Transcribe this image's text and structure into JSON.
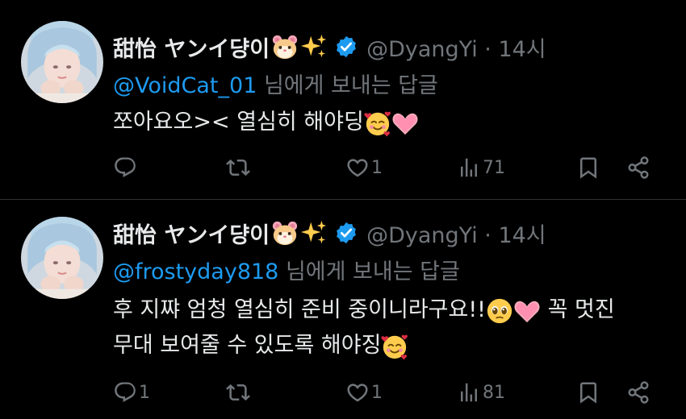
{
  "tweets": [
    {
      "name": "甜怡 ヤンイ댱이",
      "name_emojis": [
        "hamster-emoji",
        "sparkles-emoji"
      ],
      "handle_time": "@DyangYi · 14시",
      "mention": "@VoidCat_01",
      "reply_suffix": " 님에게 보내는 답글",
      "body_lines": [
        "쪼아요오>< 열심히 해야딩"
      ],
      "body_emojis": [
        "smiling-face-with-hearts-emoji",
        "pink-heart-emoji"
      ],
      "replies": "",
      "retweets": "",
      "likes": "1",
      "views": "71"
    },
    {
      "name": "甜怡 ヤンイ댱이",
      "name_emojis": [
        "hamster-emoji",
        "sparkles-emoji"
      ],
      "handle_time": "@DyangYi · 14시",
      "mention": "@frostyday818",
      "reply_suffix": " 님에게 보내는 답글",
      "body_lines": [
        "후 지쨔 엄청 열심히 준비 중이니라구요!!",
        "꼭 멋진",
        "무대 보여줄 수 있도록 해야징"
      ],
      "body_emojis": [
        "pleading-face-emoji",
        "pink-heart-emoji",
        "smiling-face-with-hearts-emoji"
      ],
      "replies": "1",
      "retweets": "",
      "likes": "1",
      "views": "81"
    }
  ],
  "colors": {
    "background": "#000000",
    "text": "#e7e9ea",
    "secondary": "#71767b",
    "link": "#1d9bf0",
    "verified": "#1d9bf0",
    "divider": "#2f3336"
  }
}
